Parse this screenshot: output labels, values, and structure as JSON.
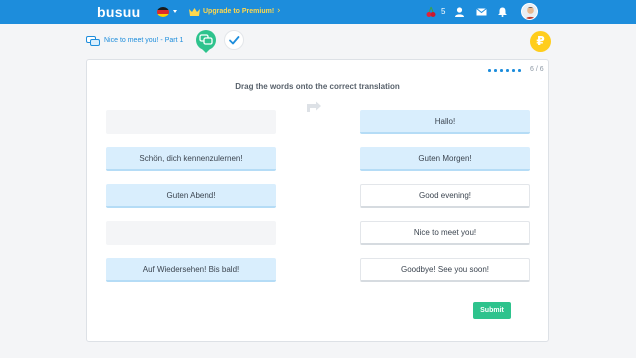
{
  "app": {
    "logo": "busuu",
    "upgrade_label": "Upgrade to Premium!",
    "upgrade_chevron": "›",
    "cherry_count": "5",
    "icons": [
      "flag-germany-icon",
      "crown-icon",
      "cherry-icon",
      "user-icon",
      "mail-icon",
      "bell-icon",
      "avatar"
    ],
    "colors": {
      "header": "#1d8ddc",
      "accent_green": "#2ec38d",
      "tile_blue": "#d9eefd",
      "coin": "#ffcd1c",
      "upgrade": "#ffd84d"
    }
  },
  "progress": {
    "lesson_link": "Nice to meet you! - Part 1",
    "coin_symbol": "₽"
  },
  "exercise": {
    "step_counter": "6 / 6",
    "instruction": "Drag the words onto the correct translation",
    "left_tiles": {
      "row2": "Schön, dich kennenzulernen!",
      "row3": "Guten Abend!",
      "row5": "Auf Wiedersehen! Bis bald!"
    },
    "right_tiles": {
      "row1": "Hallo!",
      "row2": "Guten Morgen!",
      "row3": "Good evening!",
      "row4": "Nice to meet you!",
      "row5": "Goodbye! See you soon!"
    },
    "submit_label": "Submit"
  }
}
